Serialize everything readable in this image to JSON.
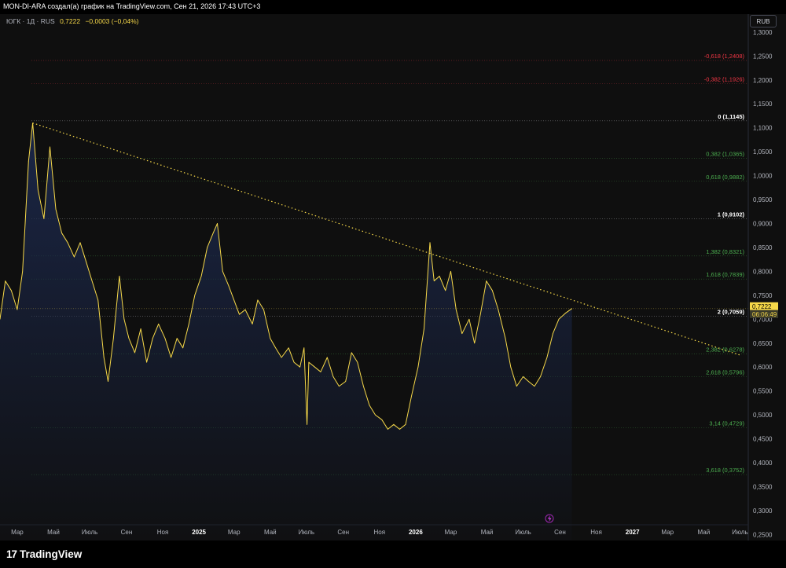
{
  "header": {
    "title": "MON-DI-ARA создал(а) график на TradingView.com, Сен 21, 2026 17:43 UTC+3"
  },
  "legend": {
    "symbol": "ЮГК · 1Д · RUS",
    "last": "0,7222",
    "change": "−0,0003 (−0,04%)"
  },
  "currency": "RUB",
  "price_badge": {
    "value": "0,7222",
    "countdown": "06:06:49"
  },
  "brand": {
    "name": "TradingView"
  },
  "colors": {
    "line": "#f7d949",
    "fill_top": "#1b2749",
    "background": "#0f0f0f",
    "fib_red": "#f23645",
    "fib_green": "#4caf50",
    "trendline": "#f7d949"
  },
  "chart_data": {
    "type": "area",
    "title": "ЮГК · 1Д · RUS",
    "y_axis": {
      "ylim": [
        0.2375,
        1.3375
      ],
      "ticks": [
        "1,3000",
        "1,2500",
        "1,2000",
        "1,1500",
        "1,1000",
        "1,0500",
        "1,0000",
        "0,9500",
        "0,9000",
        "0,8500",
        "0,8000",
        "0,7500",
        "0,7000",
        "0,6500",
        "0,6000",
        "0,5500",
        "0,5000",
        "0,4500",
        "0,4000",
        "0,3500",
        "0,3000",
        "0,2500"
      ],
      "tick_values": [
        1.3,
        1.25,
        1.2,
        1.15,
        1.1,
        1.05,
        1.0,
        0.95,
        0.9,
        0.85,
        0.8,
        0.75,
        0.7,
        0.65,
        0.6,
        0.55,
        0.5,
        0.45,
        0.4,
        0.35,
        0.3,
        0.25
      ]
    },
    "x_axis": {
      "ticks": [
        "Мар",
        "Май",
        "Июль",
        "Сен",
        "Ноя",
        "2025",
        "Мар",
        "Май",
        "Июль",
        "Сен",
        "Ноя",
        "2026",
        "Мар",
        "Май",
        "Июль",
        "Сен",
        "Ноя",
        "2027",
        "Мар",
        "Май",
        "Июль"
      ],
      "tick_dates": [
        "2024-03-01",
        "2024-05-01",
        "2024-07-01",
        "2024-09-01",
        "2024-11-01",
        "2025-01-01",
        "2025-03-01",
        "2025-05-01",
        "2025-07-01",
        "2025-09-01",
        "2025-11-01",
        "2026-01-01",
        "2026-03-01",
        "2026-05-01",
        "2026-07-01",
        "2026-09-01",
        "2026-11-01",
        "2027-01-01",
        "2027-03-01",
        "2027-05-01",
        "2027-07-01"
      ],
      "bold_ticks": [
        "2025",
        "2026",
        "2027"
      ],
      "xlim": [
        "2024-02-01",
        "2027-07-15"
      ]
    },
    "series": [
      {
        "values": [
          [
            "2024-02-01",
            0.7
          ],
          [
            "2024-02-10",
            0.78
          ],
          [
            "2024-02-20",
            0.76
          ],
          [
            "2024-03-01",
            0.72
          ],
          [
            "2024-03-10",
            0.8
          ],
          [
            "2024-03-20",
            1.03
          ],
          [
            "2024-03-27",
            1.11
          ],
          [
            "2024-04-05",
            0.97
          ],
          [
            "2024-04-15",
            0.91
          ],
          [
            "2024-04-25",
            1.06
          ],
          [
            "2024-05-05",
            0.93
          ],
          [
            "2024-05-15",
            0.88
          ],
          [
            "2024-05-25",
            0.86
          ],
          [
            "2024-06-05",
            0.83
          ],
          [
            "2024-06-15",
            0.86
          ],
          [
            "2024-06-25",
            0.82
          ],
          [
            "2024-07-05",
            0.78
          ],
          [
            "2024-07-15",
            0.74
          ],
          [
            "2024-07-25",
            0.62
          ],
          [
            "2024-08-01",
            0.57
          ],
          [
            "2024-08-10",
            0.66
          ],
          [
            "2024-08-20",
            0.79
          ],
          [
            "2024-08-28",
            0.7
          ],
          [
            "2024-09-05",
            0.66
          ],
          [
            "2024-09-15",
            0.63
          ],
          [
            "2024-09-25",
            0.68
          ],
          [
            "2024-10-05",
            0.61
          ],
          [
            "2024-10-15",
            0.66
          ],
          [
            "2024-10-25",
            0.69
          ],
          [
            "2024-11-05",
            0.66
          ],
          [
            "2024-11-15",
            0.62
          ],
          [
            "2024-11-25",
            0.66
          ],
          [
            "2024-12-05",
            0.64
          ],
          [
            "2024-12-15",
            0.69
          ],
          [
            "2024-12-25",
            0.75
          ],
          [
            "2025-01-05",
            0.79
          ],
          [
            "2025-01-15",
            0.85
          ],
          [
            "2025-01-25",
            0.88
          ],
          [
            "2025-02-01",
            0.9
          ],
          [
            "2025-02-10",
            0.8
          ],
          [
            "2025-02-20",
            0.77
          ],
          [
            "2025-03-01",
            0.74
          ],
          [
            "2025-03-10",
            0.71
          ],
          [
            "2025-03-20",
            0.72
          ],
          [
            "2025-04-01",
            0.69
          ],
          [
            "2025-04-10",
            0.74
          ],
          [
            "2025-04-20",
            0.72
          ],
          [
            "2025-05-01",
            0.66
          ],
          [
            "2025-05-10",
            0.64
          ],
          [
            "2025-05-20",
            0.62
          ],
          [
            "2025-06-01",
            0.64
          ],
          [
            "2025-06-10",
            0.61
          ],
          [
            "2025-06-20",
            0.6
          ],
          [
            "2025-06-27",
            0.64
          ],
          [
            "2025-07-02",
            0.48
          ],
          [
            "2025-07-05",
            0.61
          ],
          [
            "2025-07-15",
            0.6
          ],
          [
            "2025-07-25",
            0.59
          ],
          [
            "2025-08-05",
            0.62
          ],
          [
            "2025-08-15",
            0.58
          ],
          [
            "2025-08-25",
            0.56
          ],
          [
            "2025-09-05",
            0.57
          ],
          [
            "2025-09-15",
            0.63
          ],
          [
            "2025-09-25",
            0.61
          ],
          [
            "2025-10-05",
            0.56
          ],
          [
            "2025-10-15",
            0.52
          ],
          [
            "2025-10-25",
            0.5
          ],
          [
            "2025-11-05",
            0.49
          ],
          [
            "2025-11-15",
            0.47
          ],
          [
            "2025-11-25",
            0.48
          ],
          [
            "2025-12-05",
            0.47
          ],
          [
            "2025-12-15",
            0.48
          ],
          [
            "2025-12-25",
            0.54
          ],
          [
            "2026-01-05",
            0.6
          ],
          [
            "2026-01-15",
            0.68
          ],
          [
            "2026-01-25",
            0.86
          ],
          [
            "2026-02-01",
            0.78
          ],
          [
            "2026-02-10",
            0.79
          ],
          [
            "2026-02-20",
            0.76
          ],
          [
            "2026-03-01",
            0.8
          ],
          [
            "2026-03-10",
            0.72
          ],
          [
            "2026-03-20",
            0.67
          ],
          [
            "2026-04-01",
            0.7
          ],
          [
            "2026-04-10",
            0.65
          ],
          [
            "2026-04-20",
            0.71
          ],
          [
            "2026-04-30",
            0.78
          ],
          [
            "2026-05-10",
            0.76
          ],
          [
            "2026-05-20",
            0.72
          ],
          [
            "2026-06-01",
            0.66
          ],
          [
            "2026-06-10",
            0.6
          ],
          [
            "2026-06-20",
            0.56
          ],
          [
            "2026-07-01",
            0.58
          ],
          [
            "2026-07-10",
            0.57
          ],
          [
            "2026-07-20",
            0.56
          ],
          [
            "2026-07-30",
            0.58
          ],
          [
            "2026-08-10",
            0.62
          ],
          [
            "2026-08-20",
            0.67
          ],
          [
            "2026-08-30",
            0.7
          ],
          [
            "2026-09-10",
            0.7125
          ],
          [
            "2026-09-21",
            0.7222
          ]
        ]
      }
    ],
    "fib_levels": [
      {
        "label": "-0,618 (1,2408)",
        "value": 1.2408,
        "color": "red"
      },
      {
        "label": "-0,382 (1,1926)",
        "value": 1.1926,
        "color": "red"
      },
      {
        "label": "0 (1,1145)",
        "value": 1.1145,
        "color": "white"
      },
      {
        "label": "0,382 (1,0365)",
        "value": 1.0365,
        "color": "green"
      },
      {
        "label": "0,618 (0,9882)",
        "value": 0.9882,
        "color": "green"
      },
      {
        "label": "1 (0,9102)",
        "value": 0.9102,
        "color": "white"
      },
      {
        "label": "1,382 (0,8321)",
        "value": 0.8321,
        "color": "green"
      },
      {
        "label": "1,618 (0,7839)",
        "value": 0.7839,
        "color": "green"
      },
      {
        "label": "2 (0,7059)",
        "value": 0.7059,
        "color": "white"
      },
      {
        "label": "2,382 (0,6278)",
        "value": 0.6278,
        "color": "green"
      },
      {
        "label": "2,618 (0,5796)",
        "value": 0.5796,
        "color": "green"
      },
      {
        "label": "3,14 (0,4729)",
        "value": 0.4729,
        "color": "green"
      },
      {
        "label": "3,618 (0,3752)",
        "value": 0.3752,
        "color": "green"
      }
    ],
    "trendline": {
      "from": [
        "2024-03-27",
        1.11
      ],
      "to": [
        "2027-07-01",
        0.625
      ]
    },
    "grid": false
  }
}
